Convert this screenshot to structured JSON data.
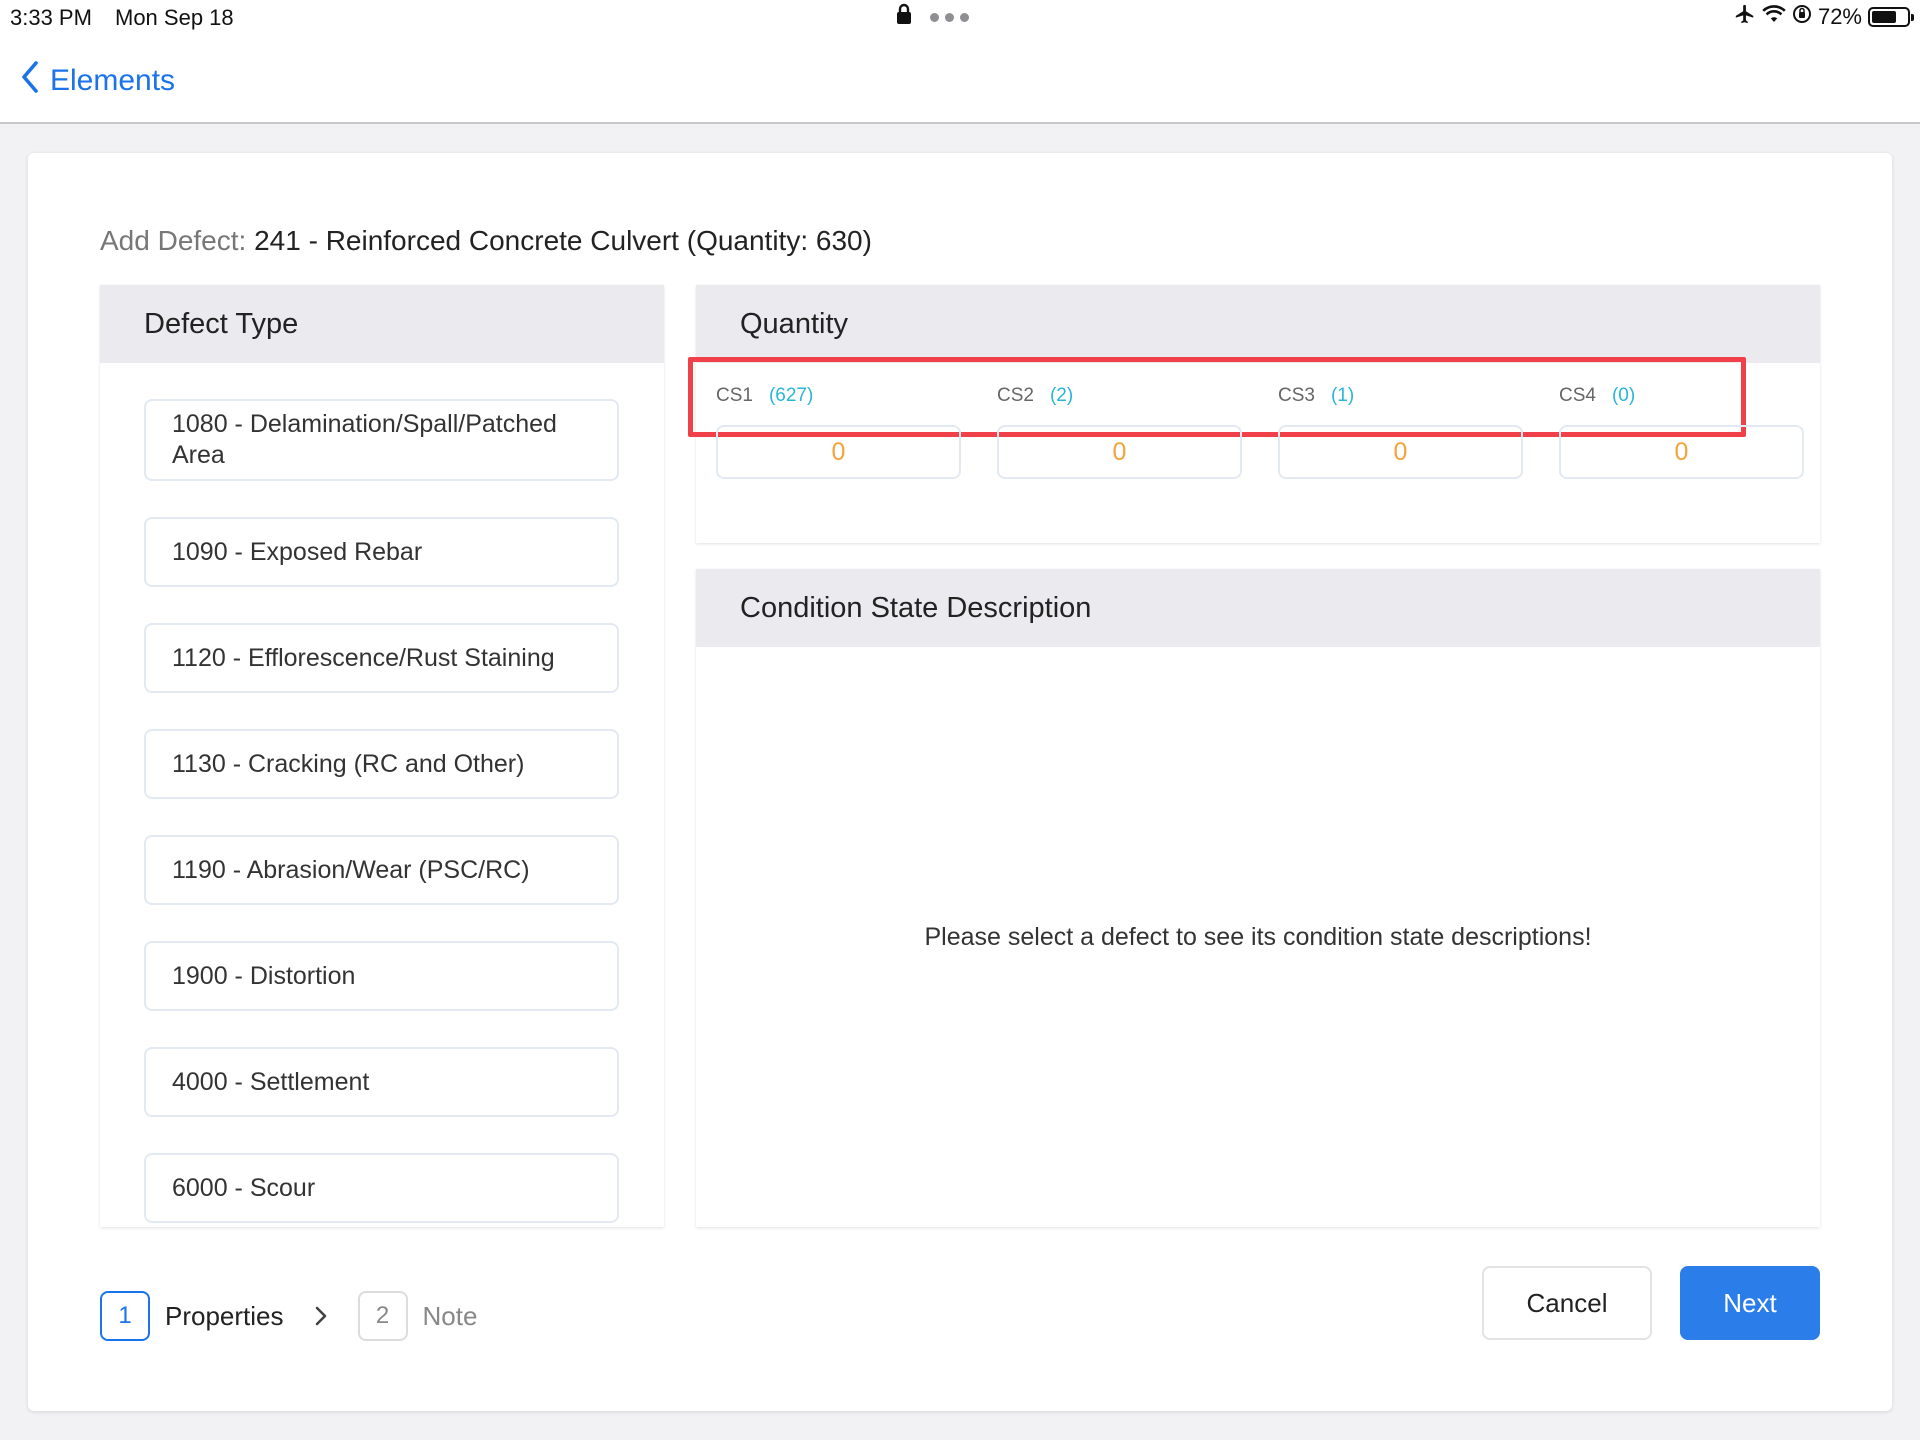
{
  "status_bar": {
    "time": "3:33 PM",
    "date": "Mon Sep 18",
    "battery_percent": "72%",
    "battery_level": 0.72,
    "icons": [
      "lock-icon",
      "more-dots-icon",
      "airplane-icon",
      "wifi-icon",
      "orientation-lock-icon",
      "battery-icon"
    ]
  },
  "nav": {
    "back_label": "Elements"
  },
  "title": {
    "prefix": "Add Defect:",
    "element": "241 - Reinforced Concrete Culvert (Quantity: 630)"
  },
  "defect_panel": {
    "header": "Defect Type",
    "items": [
      {
        "label": "1080 - Delamination/Spall/Patched Area"
      },
      {
        "label": "1090 - Exposed Rebar"
      },
      {
        "label": "1120 - Efflorescence/Rust Staining"
      },
      {
        "label": "1130 - Cracking (RC and Other)"
      },
      {
        "label": "1190 - Abrasion/Wear (PSC/RC)"
      },
      {
        "label": "1900 - Distortion"
      },
      {
        "label": "4000 - Settlement"
      },
      {
        "label": "6000 - Scour"
      }
    ]
  },
  "quantity_panel": {
    "header": "Quantity",
    "states": [
      {
        "label": "CS1",
        "count": "(627)",
        "value": "0"
      },
      {
        "label": "CS2",
        "count": "(2)",
        "value": "0"
      },
      {
        "label": "CS3",
        "count": "(1)",
        "value": "0"
      },
      {
        "label": "CS4",
        "count": "(0)",
        "value": "0"
      }
    ]
  },
  "description_panel": {
    "header": "Condition State Description",
    "message": "Please select a defect to see its condition state descriptions!"
  },
  "steps": [
    {
      "number": "1",
      "label": "Properties",
      "active": true
    },
    {
      "number": "2",
      "label": "Note",
      "active": false
    }
  ],
  "buttons": {
    "cancel": "Cancel",
    "next": "Next"
  },
  "colors": {
    "accent": "#2b7de9",
    "count": "#29b6d8",
    "value": "#f5a23a",
    "highlight": "#f0404a"
  }
}
